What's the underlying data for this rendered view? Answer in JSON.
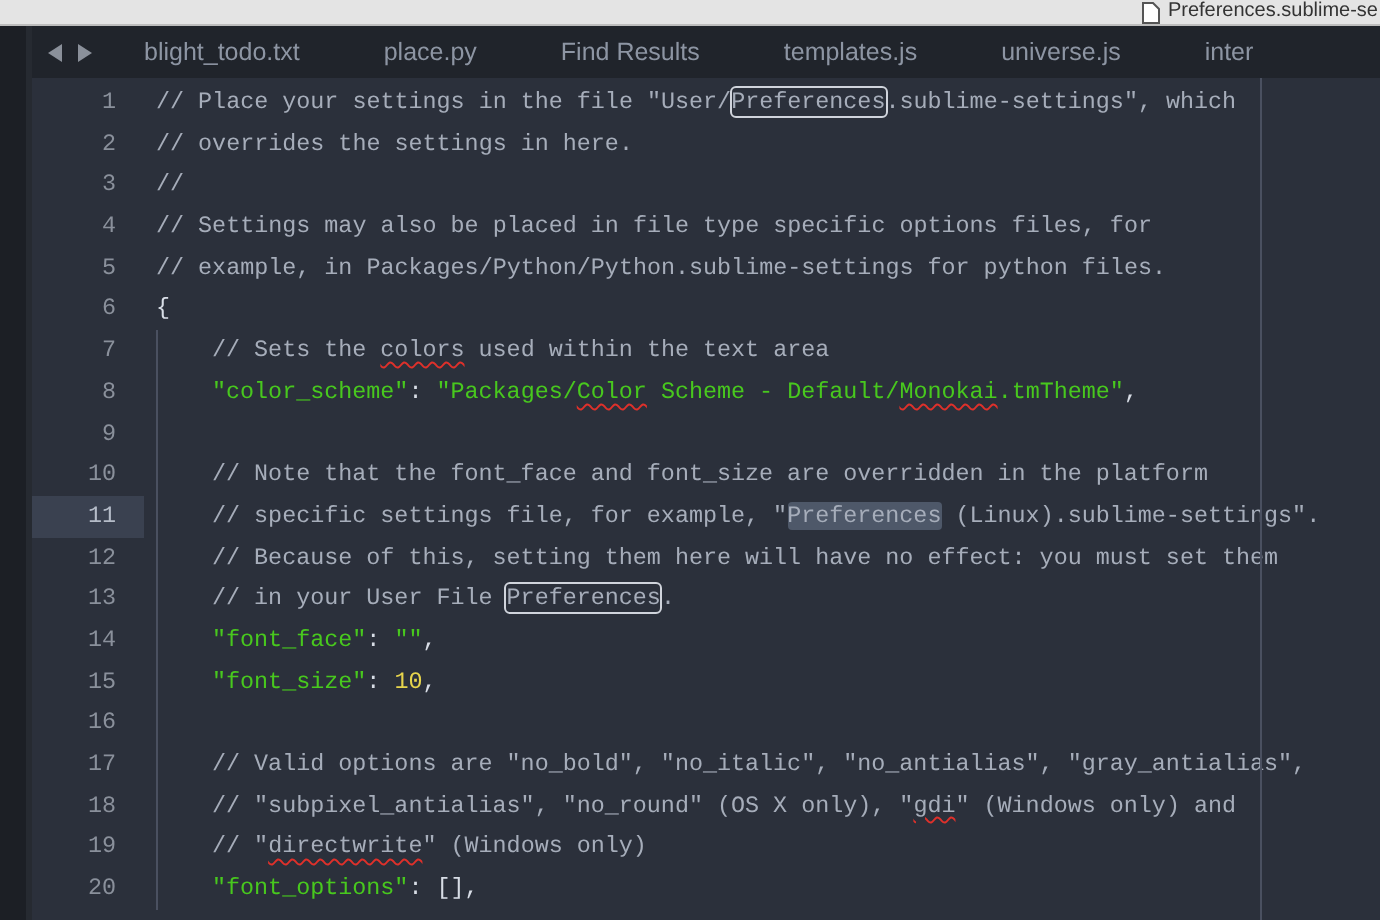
{
  "window": {
    "title": "Preferences.sublime-se"
  },
  "tabs": [
    {
      "label": "blight_todo.txt",
      "selected": false
    },
    {
      "label": "place.py",
      "selected": false
    },
    {
      "label": "Find Results",
      "selected": false
    },
    {
      "label": "templates.js",
      "selected": false
    },
    {
      "label": "universe.js",
      "selected": false
    },
    {
      "label": "inter",
      "selected": false
    }
  ],
  "editor": {
    "lines": [
      {
        "number": "1",
        "current": false,
        "indent": false,
        "segments": [
          {
            "text": "// Place your settings in the file \"User/",
            "kind": "comment"
          },
          {
            "text": "Preferences",
            "kind": "match"
          },
          {
            "text": ".sublime-settings\", which",
            "kind": "comment"
          }
        ]
      },
      {
        "number": "2",
        "current": false,
        "indent": false,
        "segments": [
          {
            "text": "// overrides the settings in here.",
            "kind": "comment"
          }
        ]
      },
      {
        "number": "3",
        "current": false,
        "indent": false,
        "segments": [
          {
            "text": "//",
            "kind": "comment"
          }
        ]
      },
      {
        "number": "4",
        "current": false,
        "indent": false,
        "segments": [
          {
            "text": "// Settings may also be placed in file type specific options files, for",
            "kind": "comment"
          }
        ]
      },
      {
        "number": "5",
        "current": false,
        "indent": false,
        "segments": [
          {
            "text": "// example, in Packages/Python/Python.sublime-settings for python files.",
            "kind": "comment"
          }
        ]
      },
      {
        "number": "6",
        "current": false,
        "indent": false,
        "segments": [
          {
            "text": "{",
            "kind": "punct"
          }
        ]
      },
      {
        "number": "7",
        "current": false,
        "indent": true,
        "segments": [
          {
            "text": "// Sets the ",
            "kind": "comment"
          },
          {
            "text": "colors",
            "kind": "typo"
          },
          {
            "text": " used within the text area",
            "kind": "comment"
          }
        ]
      },
      {
        "number": "8",
        "current": false,
        "indent": true,
        "segments": [
          {
            "text": "\"color_scheme\"",
            "kind": "string"
          },
          {
            "text": ": ",
            "kind": "punct"
          },
          {
            "text": "\"Packages/",
            "kind": "string"
          },
          {
            "text": "Color",
            "kind": "stringtypo"
          },
          {
            "text": " Scheme - Default/",
            "kind": "string"
          },
          {
            "text": "Monokai",
            "kind": "stringtypo"
          },
          {
            "text": ".tmTheme\"",
            "kind": "string"
          },
          {
            "text": ",",
            "kind": "punct"
          }
        ]
      },
      {
        "number": "9",
        "current": false,
        "indent": true
      },
      {
        "number": "10",
        "current": false,
        "indent": true,
        "segments": [
          {
            "text": "// Note that the font_face and font_size are overridden in the platform",
            "kind": "comment"
          }
        ]
      },
      {
        "number": "11",
        "current": true,
        "indent": true,
        "segments": [
          {
            "text": "// specific settings file, for example, \"",
            "kind": "comment"
          },
          {
            "text": "Preferences",
            "kind": "selection"
          },
          {
            "text": " (Linux).sublime-settings\".",
            "kind": "comment"
          }
        ]
      },
      {
        "number": "12",
        "current": false,
        "indent": true,
        "segments": [
          {
            "text": "// Because of this, setting them here will have no effect: you must set them",
            "kind": "comment"
          }
        ]
      },
      {
        "number": "13",
        "current": false,
        "indent": true,
        "segments": [
          {
            "text": "// in your User File ",
            "kind": "comment"
          },
          {
            "text": "Preferences",
            "kind": "match"
          },
          {
            "text": ".",
            "kind": "comment"
          }
        ]
      },
      {
        "number": "14",
        "current": false,
        "indent": true,
        "segments": [
          {
            "text": "\"font_face\"",
            "kind": "string"
          },
          {
            "text": ": ",
            "kind": "punct"
          },
          {
            "text": "\"\"",
            "kind": "string"
          },
          {
            "text": ",",
            "kind": "punct"
          }
        ]
      },
      {
        "number": "15",
        "current": false,
        "indent": true,
        "segments": [
          {
            "text": "\"font_size\"",
            "kind": "string"
          },
          {
            "text": ": ",
            "kind": "punct"
          },
          {
            "text": "10",
            "kind": "number"
          },
          {
            "text": ",",
            "kind": "punct"
          }
        ]
      },
      {
        "number": "16",
        "current": false,
        "indent": true
      },
      {
        "number": "17",
        "current": false,
        "indent": true,
        "segments": [
          {
            "text": "// Valid options are \"no_bold\", \"no_italic\", \"no_antialias\", \"gray_antialias\",",
            "kind": "comment"
          }
        ]
      },
      {
        "number": "18",
        "current": false,
        "indent": true,
        "segments": [
          {
            "text": "// \"subpixel_antialias\", \"no_round\" (OS X only), \"",
            "kind": "comment"
          },
          {
            "text": "gdi",
            "kind": "typo"
          },
          {
            "text": "\" (Windows only) and",
            "kind": "comment"
          }
        ]
      },
      {
        "number": "19",
        "current": false,
        "indent": true,
        "segments": [
          {
            "text": "// \"",
            "kind": "comment"
          },
          {
            "text": "directwrite",
            "kind": "typo"
          },
          {
            "text": "\" (Windows only)",
            "kind": "comment"
          }
        ]
      },
      {
        "number": "20",
        "current": false,
        "indent": true,
        "segments": [
          {
            "text": "\"font_options\"",
            "kind": "string"
          },
          {
            "text": ": [],",
            "kind": "punct"
          }
        ]
      }
    ]
  }
}
